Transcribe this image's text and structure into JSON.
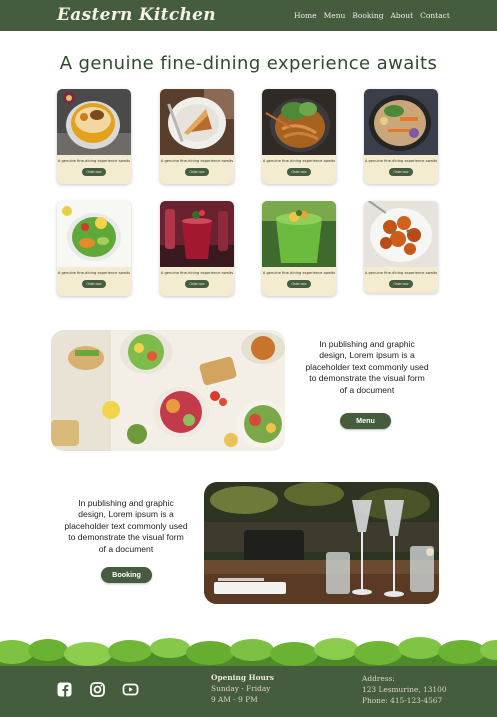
{
  "nav": {
    "brand": "Eastern Kitchen",
    "links": [
      "Home",
      "Menu",
      "Booking",
      "About",
      "Contact"
    ]
  },
  "headline": "A genuine fine-dining experience awaits",
  "cards": [
    {
      "caption": "A genuine fine-dining experience awaits",
      "button": "Order now",
      "dish": "dessert-parfait"
    },
    {
      "caption": "A genuine fine-dining experience awaits",
      "button": "Order now",
      "dish": "pie-slice"
    },
    {
      "caption": "A genuine fine-dining experience awaits",
      "button": "Order now",
      "dish": "bok-choy-noodles"
    },
    {
      "caption": "A genuine fine-dining experience awaits",
      "button": "Order now",
      "dish": "noodle-soup"
    },
    {
      "caption": "A genuine fine-dining experience awaits",
      "button": "Order now",
      "dish": "salad-bowl"
    },
    {
      "caption": "A genuine fine-dining experience awaits",
      "button": "Order now",
      "dish": "berry-drink"
    },
    {
      "caption": "A genuine fine-dining experience awaits",
      "button": "Order now",
      "dish": "green-smoothie"
    },
    {
      "caption": "A genuine fine-dining experience awaits",
      "button": "Order now",
      "dish": "glazed-chicken"
    }
  ],
  "feature_menu": {
    "text_lines": [
      "In publishing and graphic",
      "design, Lorem ipsum is a",
      "placeholder text commonly used",
      "to demonstrate the visual form",
      "of a document"
    ],
    "button": "Menu"
  },
  "feature_booking": {
    "text_lines": [
      "In publishing and graphic",
      "design, Lorem ipsum is a",
      "placeholder text commonly used",
      "to demonstrate the visual form",
      "of a document"
    ],
    "button": "Booking"
  },
  "footer": {
    "social_icons": [
      "facebook-icon",
      "instagram-icon",
      "youtube-icon"
    ],
    "hours_title": "Opening Hours",
    "hours_days": "Sunday - Friday",
    "hours_time": "9 AM - 9 PM",
    "address_title": "Address:",
    "address_line": "123 Lesmurine, 13100",
    "phone": "Phone: 415-123-4567"
  },
  "colors": {
    "primary_green": "#455c3f",
    "card_cream": "#f3ecd0",
    "headline_green": "#2f4a2c"
  }
}
